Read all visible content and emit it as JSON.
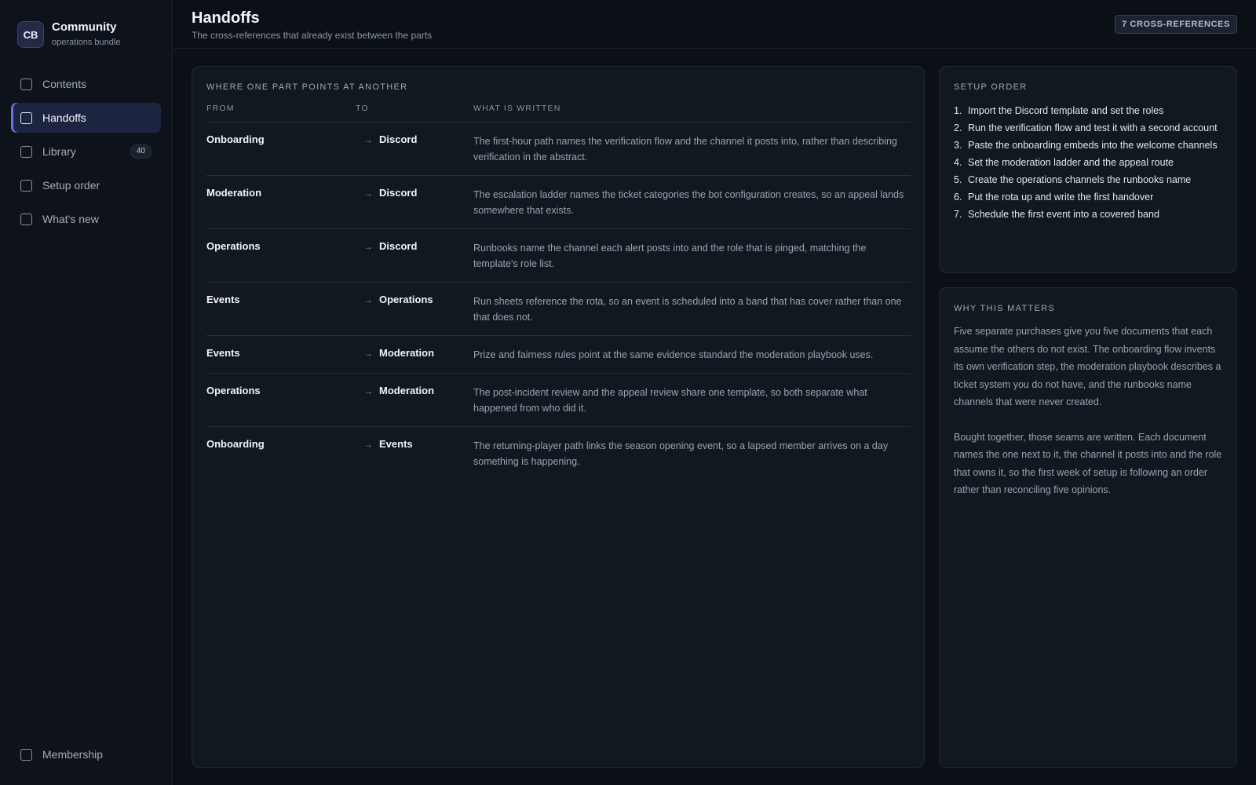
{
  "sidebar": {
    "brand": {
      "initials": "CB",
      "title": "Community",
      "subtitle": "operations bundle"
    },
    "items": [
      {
        "label": "Contents",
        "active": false
      },
      {
        "label": "Handoffs",
        "active": true
      },
      {
        "label": "Library",
        "active": false,
        "count": "40"
      },
      {
        "label": "Setup order",
        "active": false
      },
      {
        "label": "What's new",
        "active": false
      }
    ],
    "bottom_item": {
      "label": "Membership"
    }
  },
  "header": {
    "title": "Handoffs",
    "subtitle": "The cross-references that already exist between the parts",
    "badge": "7 CROSS-REFERENCES"
  },
  "handoffs": {
    "heading": "WHERE ONE PART POINTS AT ANOTHER",
    "columns": {
      "from": "FROM",
      "to": "TO",
      "what": "WHAT IS WRITTEN"
    },
    "arrow": "→",
    "rows": [
      {
        "from": "Onboarding",
        "to": "Discord",
        "what": "The first-hour path names the verification flow and the channel it posts into, rather than describing verification in the abstract."
      },
      {
        "from": "Moderation",
        "to": "Discord",
        "what": "The escalation ladder names the ticket categories the bot configuration creates, so an appeal lands somewhere that exists."
      },
      {
        "from": "Operations",
        "to": "Discord",
        "what": "Runbooks name the channel each alert posts into and the role that is pinged, matching the template's role list."
      },
      {
        "from": "Events",
        "to": "Operations",
        "what": "Run sheets reference the rota, so an event is scheduled into a band that has cover rather than one that does not."
      },
      {
        "from": "Events",
        "to": "Moderation",
        "what": "Prize and fairness rules point at the same evidence standard the moderation playbook uses."
      },
      {
        "from": "Operations",
        "to": "Moderation",
        "what": "The post-incident review and the appeal review share one template, so both separate what happened from who did it."
      },
      {
        "from": "Onboarding",
        "to": "Events",
        "what": "The returning-player path links the season opening event, so a lapsed member arrives on a day something is happening."
      }
    ]
  },
  "setup_order": {
    "heading": "SETUP ORDER",
    "steps": [
      "Import the Discord template and set the roles",
      "Run the verification flow and test it with a second account",
      "Paste the onboarding embeds into the welcome channels",
      "Set the moderation ladder and the appeal route",
      "Create the operations channels the runbooks name",
      "Put the rota up and write the first handover",
      "Schedule the first event into a covered band"
    ]
  },
  "why": {
    "heading": "WHY THIS MATTERS",
    "paragraphs": [
      "Five separate purchases give you five documents that each assume the others do not exist. The onboarding flow invents its own verification step, the moderation playbook describes a ticket system you do not have, and the runbooks name channels that were never created.",
      "Bought together, those seams are written. Each document names the one next to it, the channel it posts into and the role that owns it, so the first week of setup is following an order rather than reconciling five opinions."
    ]
  },
  "colors": {
    "accent": "#6c72e0",
    "background": "#0b1016",
    "panel": "#111820"
  }
}
